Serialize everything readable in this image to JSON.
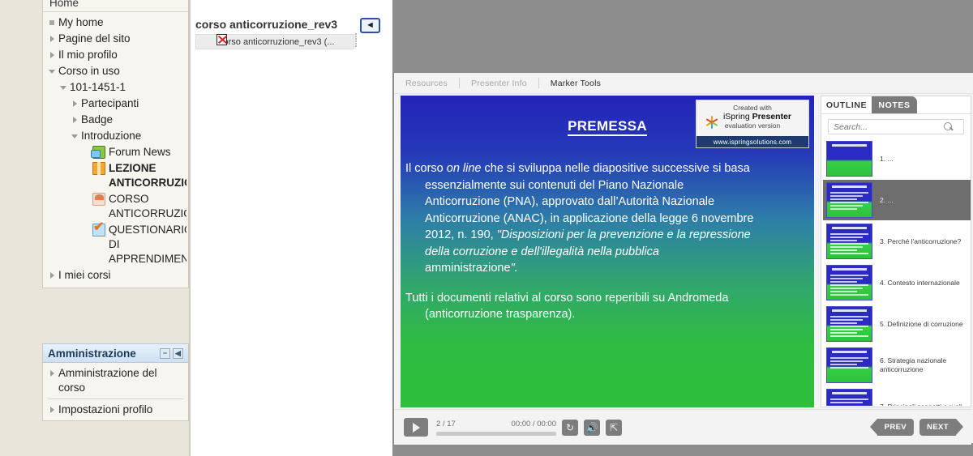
{
  "sidebar": {
    "nav_title": "Home",
    "items": [
      {
        "label": "My home",
        "depth": 1,
        "marker": "none",
        "icon": null,
        "bold": false
      },
      {
        "label": "Pagine del sito",
        "depth": 1,
        "marker": "closed",
        "icon": null,
        "bold": false
      },
      {
        "label": "Il mio profilo",
        "depth": 1,
        "marker": "closed",
        "icon": null,
        "bold": false
      },
      {
        "label": "Corso in uso",
        "depth": 1,
        "marker": "open",
        "icon": null,
        "bold": false
      },
      {
        "label": "101-1451-1",
        "depth": 2,
        "marker": "open",
        "icon": null,
        "bold": false
      },
      {
        "label": "Partecipanti",
        "depth": 3,
        "marker": "closed",
        "icon": null,
        "bold": false
      },
      {
        "label": "Badge",
        "depth": 3,
        "marker": "closed",
        "icon": null,
        "bold": false
      },
      {
        "label": "Introduzione",
        "depth": 3,
        "marker": "open",
        "icon": null,
        "bold": false
      },
      {
        "label": "Forum News",
        "depth": 4,
        "marker": "blank",
        "icon": "forum-icon",
        "bold": false
      },
      {
        "label": "LEZIONE ANTICORRUZIONE",
        "depth": 4,
        "marker": "blank",
        "icon": "scorm-package-icon",
        "bold": true
      },
      {
        "label": "CORSO ANTICORRUZIONI",
        "depth": 4,
        "marker": "blank",
        "icon": "course-icon",
        "bold": false
      },
      {
        "label": "QUESTIONARIO DI APPRENDIMENTO",
        "depth": 4,
        "marker": "blank",
        "icon": "quiz-icon",
        "bold": false
      },
      {
        "label": "I miei corsi",
        "depth": 1,
        "marker": "closed",
        "icon": null,
        "bold": false
      }
    ],
    "admin": {
      "title": "Amministrazione",
      "minimize_icon": "−",
      "dock_icon": "◀",
      "items": [
        {
          "label": "Amministrazione del corso"
        },
        {
          "label": "Impostazioni profilo"
        }
      ]
    }
  },
  "midpane": {
    "file_title": "corso anticorruzione_rev3",
    "file_item": "corso anticorruzione_rev3 (...",
    "collapse_label": "◄",
    "broken_image_icon": "broken-image-icon"
  },
  "player": {
    "toolbar": [
      {
        "label": "Resources",
        "active": false
      },
      {
        "label": "Presenter Info",
        "active": false
      },
      {
        "label": "Marker Tools",
        "active": true
      }
    ],
    "slide": {
      "title": "PREMESSA",
      "paragraphs": [
        {
          "lines": [
            {
              "text": "Il corso ",
              "indent": false,
              "segments": [
                {
                  "t": "Il corso ",
                  "i": false
                },
                {
                  "t": "on line",
                  "i": true
                },
                {
                  "t": " che si sviluppa nelle diapositive successive si basa",
                  "i": false
                }
              ]
            },
            {
              "text": "essenzialmente sui contenuti del Piano Nazionale",
              "indent": true
            },
            {
              "text": "Anticorruzione (PNA), approvato dall’Autorità Nazionale",
              "indent": true
            },
            {
              "text": "Anticorruzione (ANAC), in applicazione della legge 6 novembre",
              "indent": true
            },
            {
              "text": "2012, n. 190, \"Disposizioni per la prevenzione e la repressione",
              "indent": true
            },
            {
              "text": "della corruzione e dell'illegalità nella pubblica",
              "indent": true
            },
            {
              "text": "amministrazione\".",
              "indent": true
            }
          ]
        },
        {
          "lines": [
            {
              "text": "Tutti i documenti relativi al corso sono reperibili su  Andromeda",
              "indent": false
            },
            {
              "text": "(anticorruzione trasparenza).",
              "indent": true
            }
          ]
        }
      ],
      "watermark": {
        "created_with": "Created with",
        "product_prefix": "iSpring ",
        "product_name": "Presenter",
        "edition": "evaluation version",
        "url": "www.ispringsolutions.com"
      }
    },
    "outline": {
      "tabs": [
        {
          "label": "OUTLINE",
          "active": true
        },
        {
          "label": "NOTES",
          "active": false
        }
      ],
      "search_placeholder": "Search...",
      "search_value": "",
      "search_icon": "search-icon",
      "slides": [
        {
          "num": "1.",
          "label": "...",
          "selected": false,
          "lines": 0
        },
        {
          "num": "2.",
          "label": "...",
          "selected": true,
          "lines": 6
        },
        {
          "num": "3.",
          "label": "Perché l'anticorruzione?",
          "selected": false,
          "lines": 7
        },
        {
          "num": "4.",
          "label": "Contesto internazionale",
          "selected": false,
          "lines": 7
        },
        {
          "num": "5.",
          "label": "Definizione di corruzione",
          "selected": false,
          "lines": 7
        },
        {
          "num": "6.",
          "label": "Strategia nazionale anticorruzione",
          "selected": false,
          "lines": 4
        },
        {
          "num": "7.",
          "label": "Principali soggetti e ruoli",
          "selected": false,
          "lines": 2
        }
      ]
    },
    "controls": {
      "play_icon": "play-icon",
      "slide_counter": "2 / 17",
      "time": "00:00 / 00:00",
      "replay_icon": "replay-icon",
      "volume_icon": "volume-icon",
      "fullscreen_icon": "fullscreen-icon",
      "prev_label": "PREV",
      "next_label": "NEXT"
    }
  },
  "colors": {
    "slide_top": "#2323b8",
    "slide_bottom": "#2dbf3c",
    "player_chrome": "#8c8c8c",
    "control_gray": "#7d7d7d",
    "sidebar_bg": "#e9e5db",
    "block_bg": "#f6f5f0",
    "admin_header": "#cfe0f2"
  }
}
